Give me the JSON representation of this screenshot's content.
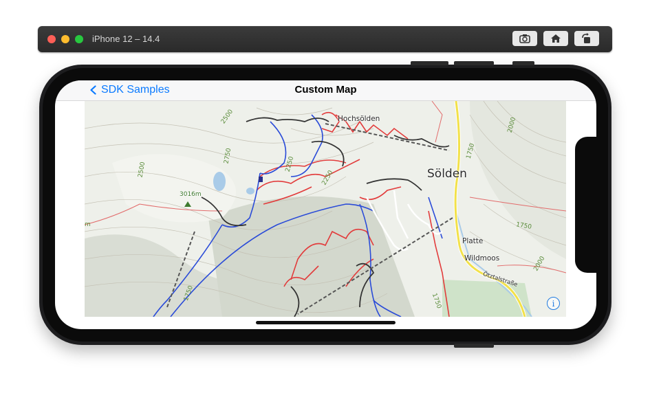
{
  "simulator": {
    "title": "iPhone 12 – 14.4",
    "buttons": [
      "screenshot-icon",
      "home-icon",
      "rotate-icon"
    ]
  },
  "navbar": {
    "back_label": "SDK Samples",
    "title": "Custom Map"
  },
  "map": {
    "places": {
      "hochsoelden": "Hochsölden",
      "soelden": "Sölden",
      "platte": "Platte",
      "wildmoos": "Wildmoos",
      "road": "Ötztalstraße",
      "peak": "3016m"
    },
    "contours": [
      "2500",
      "2750",
      "2500",
      "2250",
      "2250",
      "2000",
      "1750",
      "1750",
      "2000",
      "1750",
      "m"
    ],
    "colors": {
      "red_run": "#e23b3b",
      "blue_run": "#2a4bd8",
      "black_run": "#333333",
      "road": "#f2e14a",
      "info": "#1f7ae0"
    },
    "info_icon": "info-icon"
  }
}
